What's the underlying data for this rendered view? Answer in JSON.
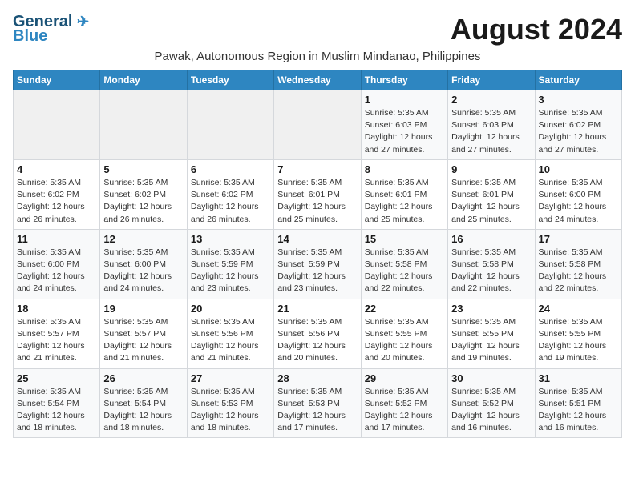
{
  "logo": {
    "line1": "General",
    "line2": "Blue"
  },
  "title": "August 2024",
  "location": "Pawak, Autonomous Region in Muslim Mindanao, Philippines",
  "days_of_week": [
    "Sunday",
    "Monday",
    "Tuesday",
    "Wednesday",
    "Thursday",
    "Friday",
    "Saturday"
  ],
  "weeks": [
    [
      {
        "day": "",
        "info": ""
      },
      {
        "day": "",
        "info": ""
      },
      {
        "day": "",
        "info": ""
      },
      {
        "day": "",
        "info": ""
      },
      {
        "day": "1",
        "info": "Sunrise: 5:35 AM\nSunset: 6:03 PM\nDaylight: 12 hours and 27 minutes."
      },
      {
        "day": "2",
        "info": "Sunrise: 5:35 AM\nSunset: 6:03 PM\nDaylight: 12 hours and 27 minutes."
      },
      {
        "day": "3",
        "info": "Sunrise: 5:35 AM\nSunset: 6:02 PM\nDaylight: 12 hours and 27 minutes."
      }
    ],
    [
      {
        "day": "4",
        "info": "Sunrise: 5:35 AM\nSunset: 6:02 PM\nDaylight: 12 hours and 26 minutes."
      },
      {
        "day": "5",
        "info": "Sunrise: 5:35 AM\nSunset: 6:02 PM\nDaylight: 12 hours and 26 minutes."
      },
      {
        "day": "6",
        "info": "Sunrise: 5:35 AM\nSunset: 6:02 PM\nDaylight: 12 hours and 26 minutes."
      },
      {
        "day": "7",
        "info": "Sunrise: 5:35 AM\nSunset: 6:01 PM\nDaylight: 12 hours and 25 minutes."
      },
      {
        "day": "8",
        "info": "Sunrise: 5:35 AM\nSunset: 6:01 PM\nDaylight: 12 hours and 25 minutes."
      },
      {
        "day": "9",
        "info": "Sunrise: 5:35 AM\nSunset: 6:01 PM\nDaylight: 12 hours and 25 minutes."
      },
      {
        "day": "10",
        "info": "Sunrise: 5:35 AM\nSunset: 6:00 PM\nDaylight: 12 hours and 24 minutes."
      }
    ],
    [
      {
        "day": "11",
        "info": "Sunrise: 5:35 AM\nSunset: 6:00 PM\nDaylight: 12 hours and 24 minutes."
      },
      {
        "day": "12",
        "info": "Sunrise: 5:35 AM\nSunset: 6:00 PM\nDaylight: 12 hours and 24 minutes."
      },
      {
        "day": "13",
        "info": "Sunrise: 5:35 AM\nSunset: 5:59 PM\nDaylight: 12 hours and 23 minutes."
      },
      {
        "day": "14",
        "info": "Sunrise: 5:35 AM\nSunset: 5:59 PM\nDaylight: 12 hours and 23 minutes."
      },
      {
        "day": "15",
        "info": "Sunrise: 5:35 AM\nSunset: 5:58 PM\nDaylight: 12 hours and 22 minutes."
      },
      {
        "day": "16",
        "info": "Sunrise: 5:35 AM\nSunset: 5:58 PM\nDaylight: 12 hours and 22 minutes."
      },
      {
        "day": "17",
        "info": "Sunrise: 5:35 AM\nSunset: 5:58 PM\nDaylight: 12 hours and 22 minutes."
      }
    ],
    [
      {
        "day": "18",
        "info": "Sunrise: 5:35 AM\nSunset: 5:57 PM\nDaylight: 12 hours and 21 minutes."
      },
      {
        "day": "19",
        "info": "Sunrise: 5:35 AM\nSunset: 5:57 PM\nDaylight: 12 hours and 21 minutes."
      },
      {
        "day": "20",
        "info": "Sunrise: 5:35 AM\nSunset: 5:56 PM\nDaylight: 12 hours and 21 minutes."
      },
      {
        "day": "21",
        "info": "Sunrise: 5:35 AM\nSunset: 5:56 PM\nDaylight: 12 hours and 20 minutes."
      },
      {
        "day": "22",
        "info": "Sunrise: 5:35 AM\nSunset: 5:55 PM\nDaylight: 12 hours and 20 minutes."
      },
      {
        "day": "23",
        "info": "Sunrise: 5:35 AM\nSunset: 5:55 PM\nDaylight: 12 hours and 19 minutes."
      },
      {
        "day": "24",
        "info": "Sunrise: 5:35 AM\nSunset: 5:55 PM\nDaylight: 12 hours and 19 minutes."
      }
    ],
    [
      {
        "day": "25",
        "info": "Sunrise: 5:35 AM\nSunset: 5:54 PM\nDaylight: 12 hours and 18 minutes."
      },
      {
        "day": "26",
        "info": "Sunrise: 5:35 AM\nSunset: 5:54 PM\nDaylight: 12 hours and 18 minutes."
      },
      {
        "day": "27",
        "info": "Sunrise: 5:35 AM\nSunset: 5:53 PM\nDaylight: 12 hours and 18 minutes."
      },
      {
        "day": "28",
        "info": "Sunrise: 5:35 AM\nSunset: 5:53 PM\nDaylight: 12 hours and 17 minutes."
      },
      {
        "day": "29",
        "info": "Sunrise: 5:35 AM\nSunset: 5:52 PM\nDaylight: 12 hours and 17 minutes."
      },
      {
        "day": "30",
        "info": "Sunrise: 5:35 AM\nSunset: 5:52 PM\nDaylight: 12 hours and 16 minutes."
      },
      {
        "day": "31",
        "info": "Sunrise: 5:35 AM\nSunset: 5:51 PM\nDaylight: 12 hours and 16 minutes."
      }
    ]
  ]
}
